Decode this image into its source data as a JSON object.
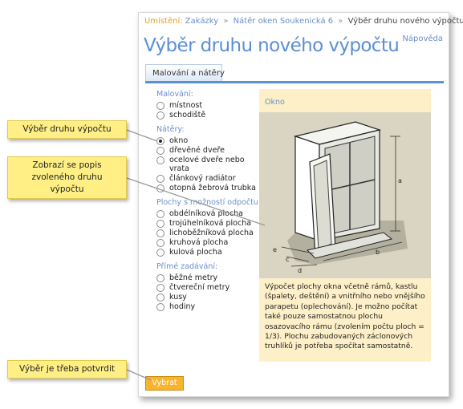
{
  "breadcrumb": {
    "label": "Umístění:",
    "items": [
      "Zakázky",
      "Nátěr oken Soukenická 6"
    ],
    "current": "Výběr druhu nového výpočtu"
  },
  "help_link": "Nápověda",
  "page_title": "Výběr druhu nového výpočtu",
  "tabs": [
    {
      "label": "Malování a nátěry",
      "active": true
    }
  ],
  "groups": [
    {
      "title": "Malování:",
      "options": [
        "místnost",
        "schodiště"
      ]
    },
    {
      "title": "Nátěry:",
      "options": [
        "okno",
        "dřevěné dveře",
        "ocelové dveře nebo vrata",
        "článkový radiátor",
        "otopná žebrová trubka"
      ]
    },
    {
      "title": "Plochy s možností odpočtu:",
      "options": [
        "obdélníková plocha",
        "trojúhelníková plocha",
        "lichoběžníková plocha",
        "kruhová plocha",
        "kulová plocha"
      ]
    },
    {
      "title": "Přímé zadávání:",
      "options": [
        "běžné metry",
        "čtvereční metry",
        "kusy",
        "hodiny"
      ]
    }
  ],
  "selected_option": "okno",
  "info": {
    "title": "Okno",
    "image_labels": {
      "a": "a",
      "b": "b",
      "c": "c",
      "d": "d",
      "e": "e"
    },
    "description": "Výpočet plochy okna včetně rámů, kastlu (špalety, deštění) a vnitřního nebo vnějšího parapetu (oplechování). Je možno počítat také pouze samostatnou plochu osazovacího rámu (zvolením počtu ploch = 1/3). Plochu zabudovaných záclonových truhlíků je potřeba spočítat samostatně."
  },
  "submit_button": "Vybrat",
  "callouts": {
    "selection": "Výběr druhu výpočtu",
    "description": "Zobrazí se popis zvoleného druhu výpočtu",
    "confirm": "Výběr je třeba potvrdit"
  },
  "colors": {
    "accent": "#5b8fd6",
    "link": "#6b8fc9",
    "button": "#f7b42c",
    "callout": "#ffef85",
    "info_bg": "#fdf0c8"
  }
}
